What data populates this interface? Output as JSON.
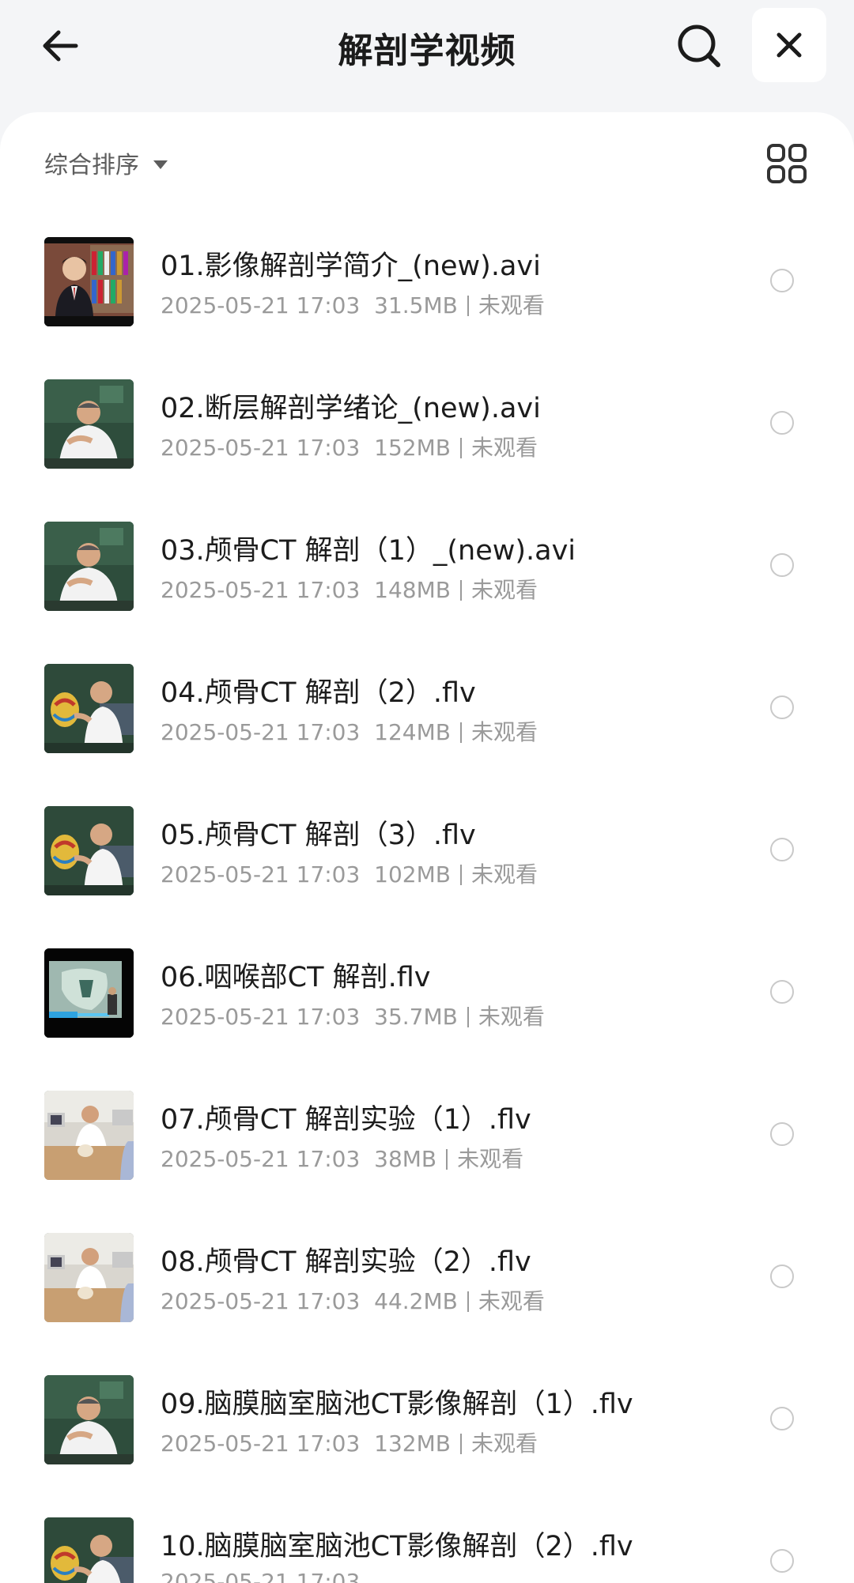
{
  "header": {
    "title": "解剖学视频",
    "back_icon": "arrow-left-icon",
    "search_icon": "search-icon",
    "close_icon": "close-icon"
  },
  "toolbar": {
    "sort_label": "综合排序",
    "grid_icon": "grid-view-icon"
  },
  "files": [
    {
      "name": "01.影像解剖学简介_(new).avi",
      "date": "2025-05-21 17:03",
      "size": "31.5MB",
      "status": "未观看",
      "thumb": "library"
    },
    {
      "name": "02.断层解剖学绪论_(new).avi",
      "date": "2025-05-21 17:03",
      "size": "152MB",
      "status": "未观看",
      "thumb": "lecture"
    },
    {
      "name": "03.颅骨CT 解剖（1）_(new).avi",
      "date": "2025-05-21 17:03",
      "size": "148MB",
      "status": "未观看",
      "thumb": "lecture"
    },
    {
      "name": "04.颅骨CT 解剖（2）.flv",
      "date": "2025-05-21 17:03",
      "size": "124MB",
      "status": "未观看",
      "thumb": "model"
    },
    {
      "name": "05.颅骨CT 解剖（3）.flv",
      "date": "2025-05-21 17:03",
      "size": "102MB",
      "status": "未观看",
      "thumb": "model"
    },
    {
      "name": "06.咽喉部CT 解剖.flv",
      "date": "2025-05-21 17:03",
      "size": "35.7MB",
      "status": "未观看",
      "thumb": "screen"
    },
    {
      "name": "07.颅骨CT 解剖实验（1）.flv",
      "date": "2025-05-21 17:03",
      "size": "38MB",
      "status": "未观看",
      "thumb": "lab"
    },
    {
      "name": "08.颅骨CT 解剖实验（2）.flv",
      "date": "2025-05-21 17:03",
      "size": "44.2MB",
      "status": "未观看",
      "thumb": "lab"
    },
    {
      "name": "09.脑膜脑室脑池CT影像解剖（1）.flv",
      "date": "2025-05-21 17:03",
      "size": "132MB",
      "status": "未观看",
      "thumb": "lecture"
    },
    {
      "name": "10.脑膜脑室脑池CT影像解剖（2）.flv",
      "date": "2025-05-21 17:03",
      "size": "",
      "status": "",
      "thumb": "model"
    }
  ]
}
